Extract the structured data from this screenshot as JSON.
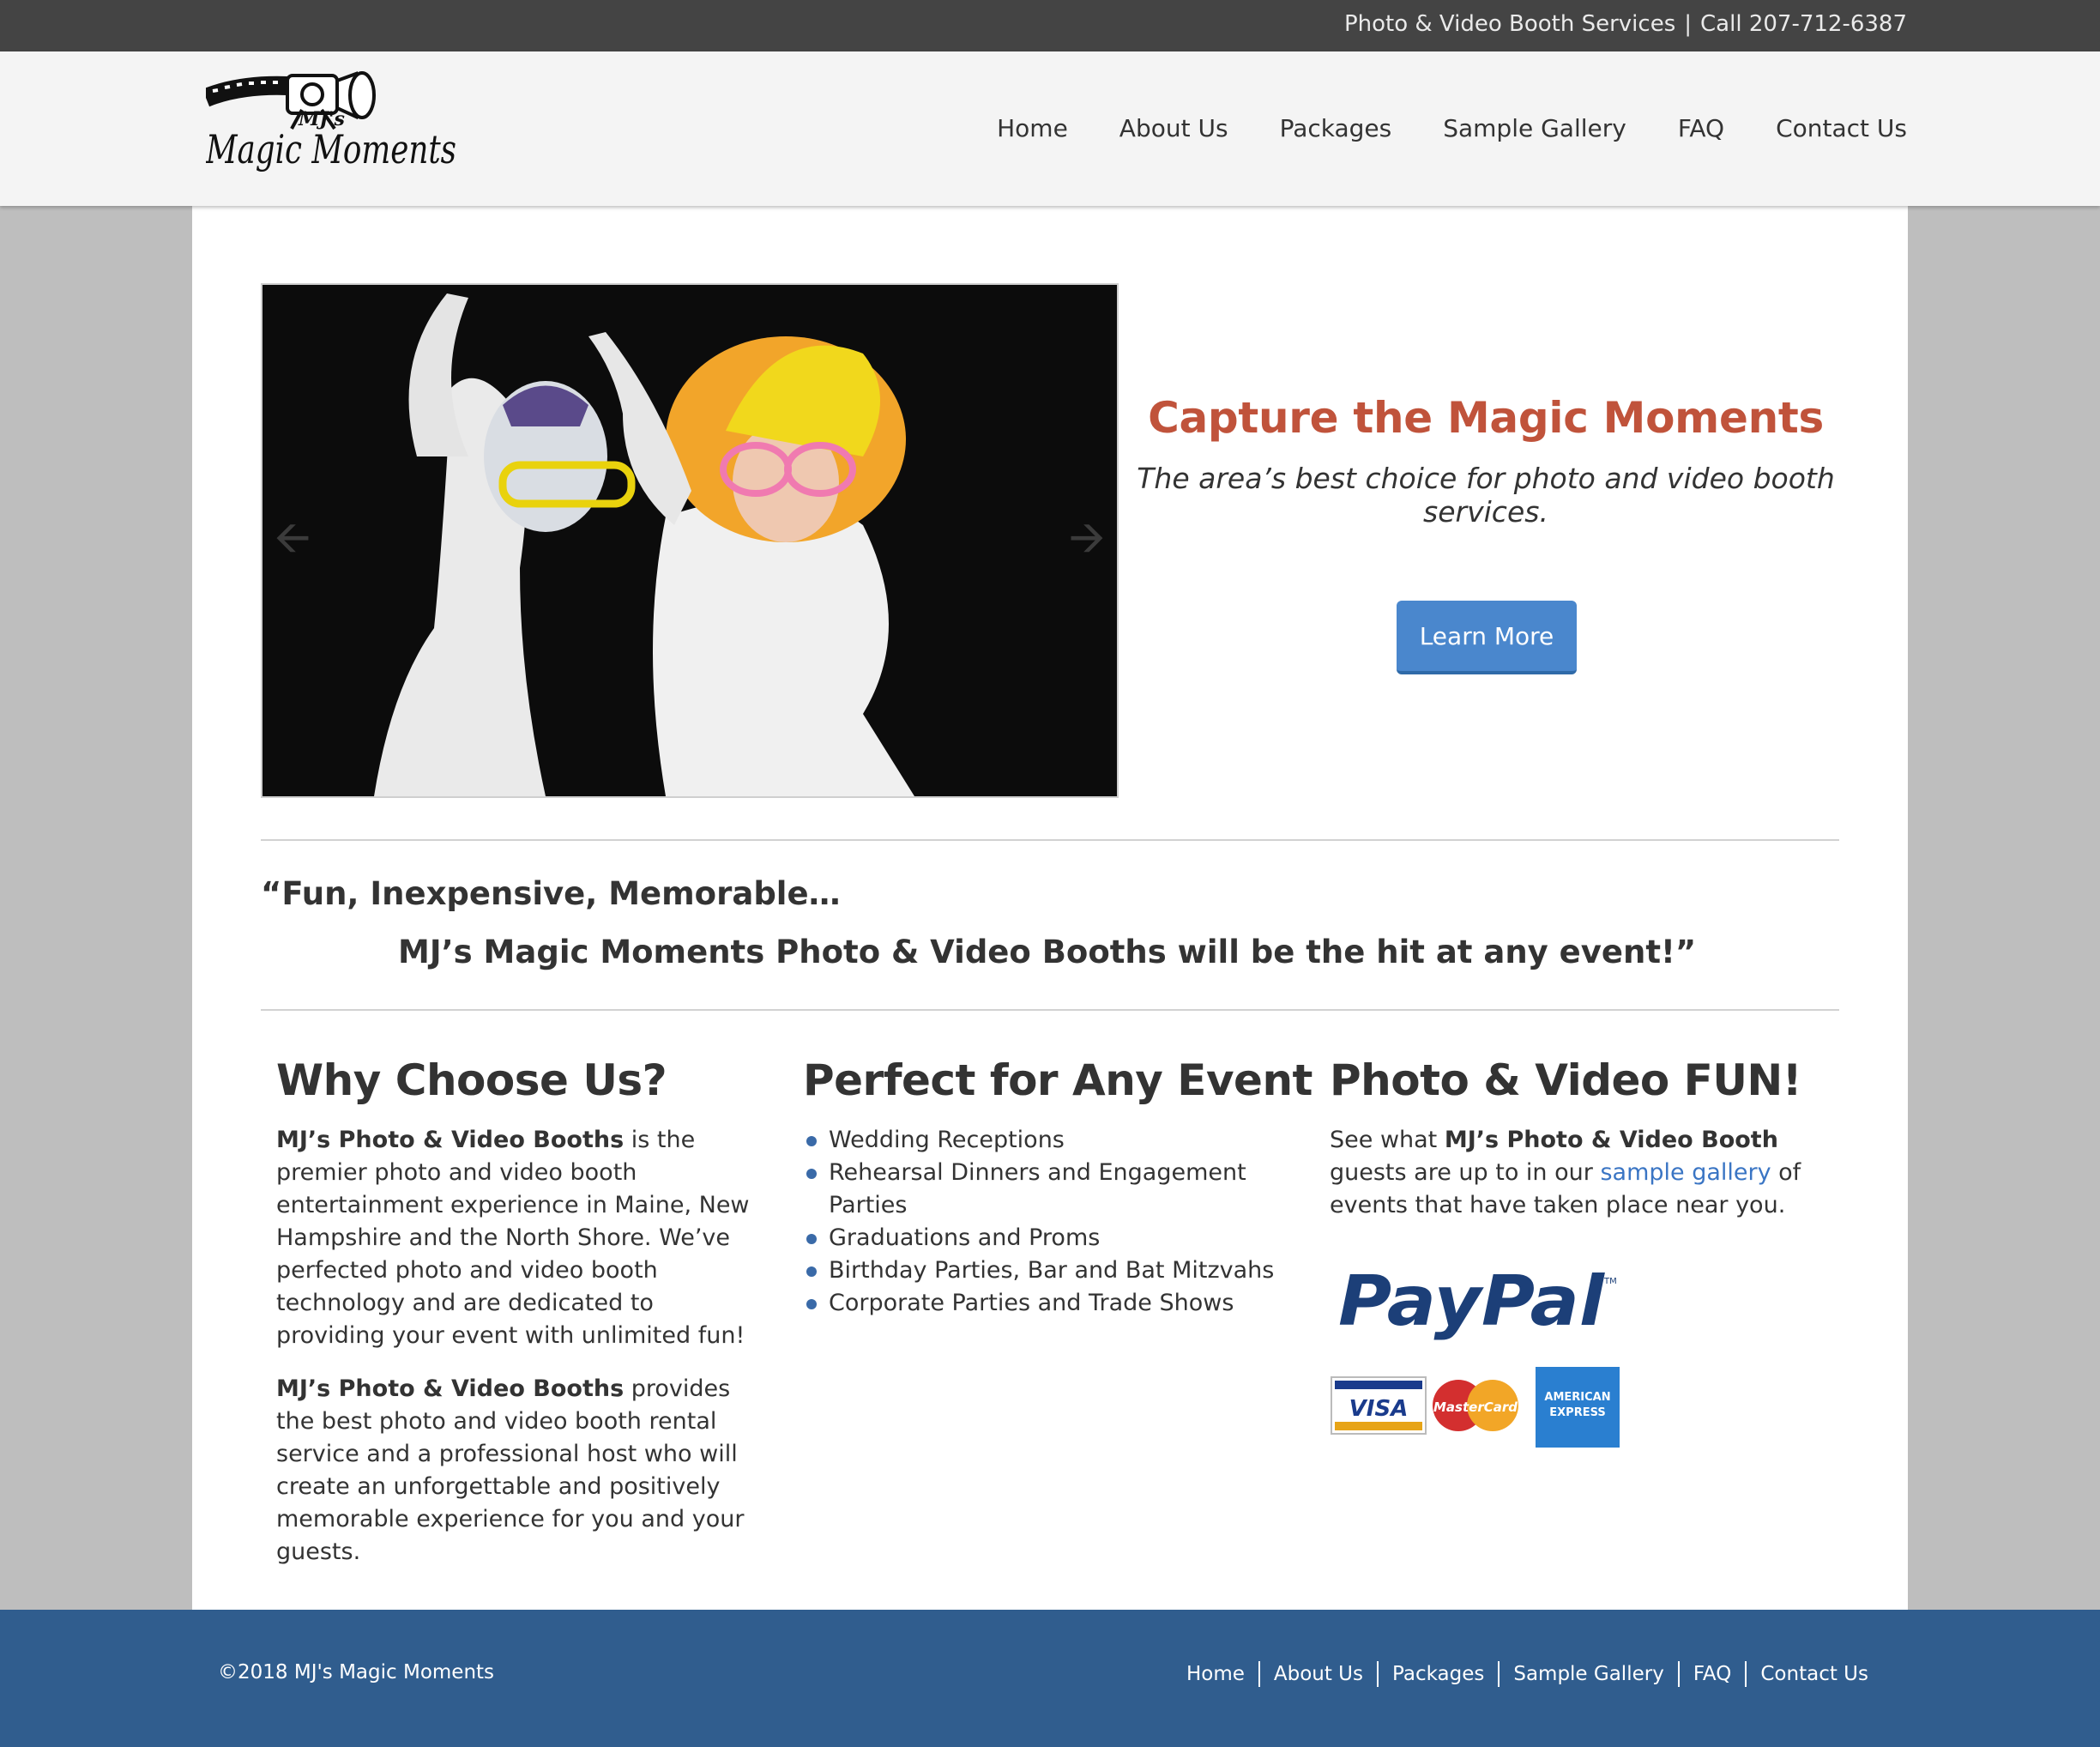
{
  "topbar": {
    "services": "Photo & Video Booth Services",
    "separator": "|",
    "phone": "Call 207-712-6387"
  },
  "header": {
    "logo_text_small": "MJ's",
    "logo_text_main": "Magic Moments",
    "nav": [
      "Home",
      "About Us",
      "Packages",
      "Sample Gallery",
      "FAQ",
      "Contact Us"
    ]
  },
  "hero": {
    "title": "Capture the Magic Moments",
    "subtitle": "The area’s best choice for photo and video booth services.",
    "button": "Learn More",
    "arrow_left_icon": "arrow-left-icon",
    "arrow_right_icon": "arrow-right-icon"
  },
  "quote": {
    "line1": "“Fun, Inexpensive, Memorable…",
    "line2": "MJ’s Magic Moments Photo & Video Booths will be the hit at any event!”"
  },
  "why": {
    "title": "Why Choose Us?",
    "p1_bold": "MJ’s Photo & Video Booths",
    "p1_rest": " is the premier photo and video booth entertainment experience in Maine, New Hampshire and the North Shore. We’ve perfected photo and video booth technology and are dedicated to providing your event with unlimited fun!",
    "p2_bold": "MJ’s Photo & Video Booths",
    "p2_rest": " provides the best photo and video booth rental service and a professional host who will create an unforgettable and positively memorable experience for you and your guests."
  },
  "events": {
    "title": "Perfect for Any Event",
    "items": [
      "Wedding Receptions",
      "Rehearsal Dinners and Engagement Parties",
      "Graduations and Proms",
      "Birthday Parties, Bar and Bat Mitzvahs",
      "Corporate Parties and Trade Shows"
    ]
  },
  "fun": {
    "title": "Photo & Video FUN!",
    "text_a": "See what ",
    "text_bold": "MJ’s Photo & Video Booth",
    "text_b": " guests are up to in our ",
    "link": "sample gallery",
    "text_c": " of events that have taken place near you.",
    "paypal": "PayPal",
    "tm": "TM",
    "visa": "VISA",
    "mastercard": "MasterCard",
    "amex_line1": "AMERICAN",
    "amex_line2": "EXPRESS"
  },
  "footer": {
    "copyright": "©2018 MJ's Magic Moments",
    "nav": [
      "Home",
      "About Us",
      "Packages",
      "Sample Gallery",
      "FAQ",
      "Contact Us"
    ]
  },
  "colors": {
    "topbar": "#444444",
    "accent_title": "#c0533b",
    "button": "#4a87cd",
    "footer": "#305d8e",
    "link": "#3a75c4"
  }
}
